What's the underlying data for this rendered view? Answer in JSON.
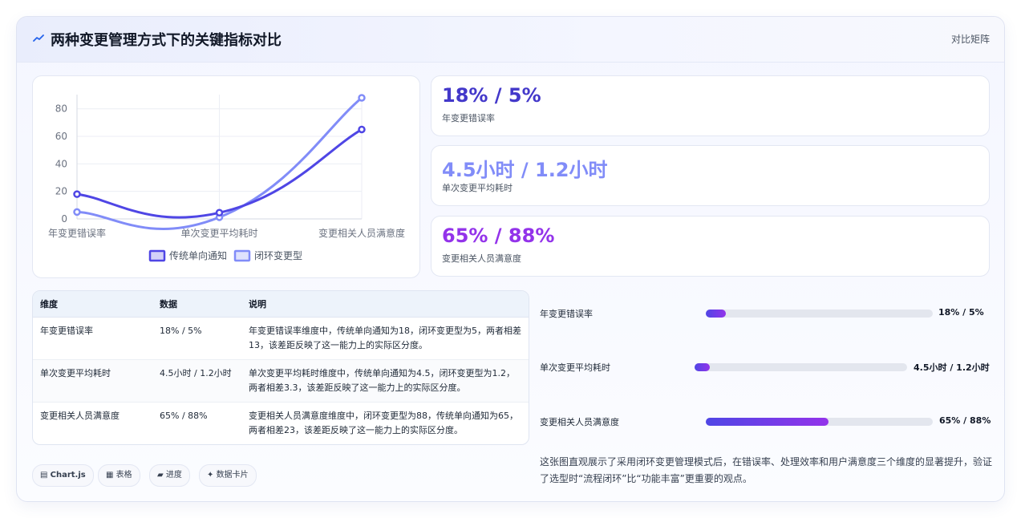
{
  "header": {
    "title": "两种变更管理方式下的关键指标对比",
    "badge": "对比矩阵"
  },
  "chart_data": {
    "type": "line",
    "categories": [
      "年变更错误率",
      "单次变更平均耗时",
      "变更相关人员满意度"
    ],
    "series": [
      {
        "name": "传统单向通知",
        "values": [
          18,
          4.5,
          65
        ],
        "color": "#4f46e5"
      },
      {
        "name": "闭环变更型",
        "values": [
          5,
          1.2,
          88
        ],
        "color": "#818cf8"
      }
    ],
    "y_ticks": [
      0,
      20,
      40,
      60,
      80
    ],
    "ylim": [
      0,
      88
    ],
    "grid": true,
    "legend_position": "bottom"
  },
  "stats": [
    {
      "value": "18% / 5%",
      "label": "年变更错误率",
      "color": "#4338ca"
    },
    {
      "value": "4.5小时 / 1.2小时",
      "label": "单次变更平均耗时",
      "color": "#818cf8"
    },
    {
      "value": "65% / 88%",
      "label": "变更相关人员满意度",
      "color": "#9333ea"
    }
  ],
  "table": {
    "headers": [
      "维度",
      "数据",
      "说明"
    ],
    "rows": [
      [
        "年变更错误率",
        "18% / 5%",
        "年变更错误率维度中，传统单向通知为18，闭环变更型为5，两者相差13，该差距反映了这一能力上的实际区分度。"
      ],
      [
        "单次变更平均耗时",
        "4.5小时 / 1.2小时",
        "单次变更平均耗时维度中，传统单向通知为4.5，闭环变更型为1.2，两者相差3.3，该差距反映了这一能力上的实际区分度。"
      ],
      [
        "变更相关人员满意度",
        "65% / 88%",
        "变更相关人员满意度维度中，闭环变更型为88，传统单向通知为65，两者相差23，该差距反映了这一能力上的实际区分度。"
      ]
    ]
  },
  "pills": [
    {
      "icon": "chart-icon",
      "glyph": "▤",
      "label": "Chart.js"
    },
    {
      "icon": "table-icon",
      "glyph": "▦",
      "label": "表格"
    },
    {
      "icon": "progress-icon",
      "glyph": "▰",
      "label": "进度"
    },
    {
      "icon": "sparkle-icon",
      "glyph": "✦",
      "label": "数据卡片"
    }
  ],
  "progress": [
    {
      "label": "年变更错误率",
      "fraction": 0.09,
      "value": "18% / 5%"
    },
    {
      "label": "单次变更平均耗时",
      "fraction": 0.07,
      "value": "4.5小时 / 1.2小时"
    },
    {
      "label": "变更相关人员满意度",
      "fraction": 0.54,
      "value": "65% / 88%"
    }
  ],
  "summary": "这张图直观展示了采用闭环变更管理模式后，在错误率、处理效率和用户满意度三个维度的显著提升，验证了选型时“流程闭环”比“功能丰富”更重要的观点。"
}
